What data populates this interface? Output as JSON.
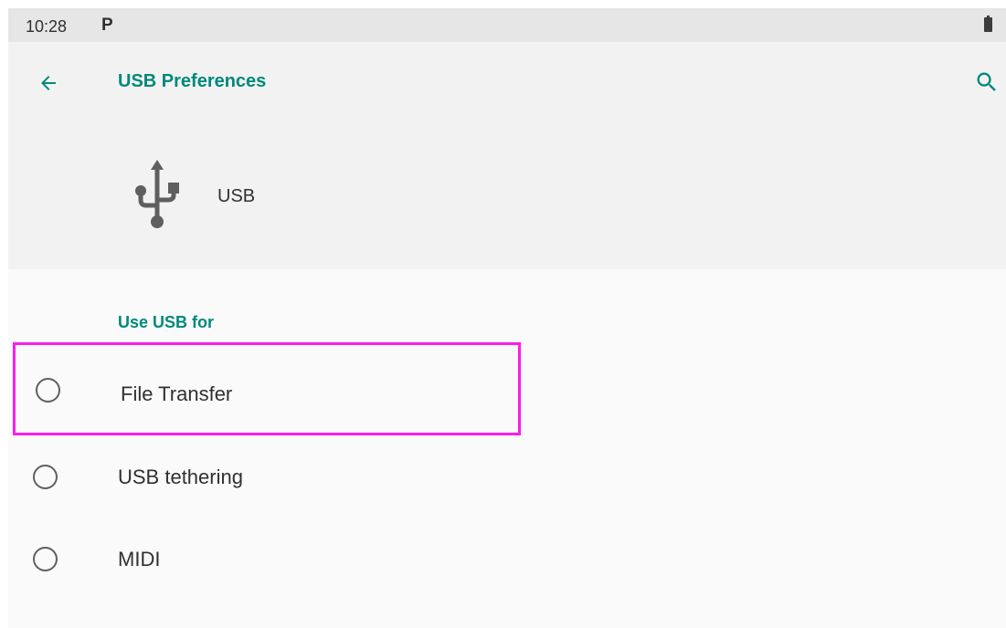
{
  "status_bar": {
    "time": "10:28",
    "notification_icon": "p-icon",
    "battery_icon": "battery-icon"
  },
  "app_bar": {
    "title": "USB Preferences",
    "back_icon": "arrow-left-icon",
    "search_icon": "search-icon"
  },
  "header": {
    "icon": "usb-icon",
    "label": "USB"
  },
  "section": {
    "title": "Use USB for"
  },
  "options": [
    {
      "label": "File Transfer",
      "selected": false,
      "highlighted": true
    },
    {
      "label": "USB tethering",
      "selected": false,
      "highlighted": false
    },
    {
      "label": "MIDI",
      "selected": false,
      "highlighted": false
    }
  ],
  "colors": {
    "accent": "#00897b",
    "highlight_box": "#ff1af0",
    "status_bar": "#e6e6e6",
    "background": "#fafafa"
  }
}
